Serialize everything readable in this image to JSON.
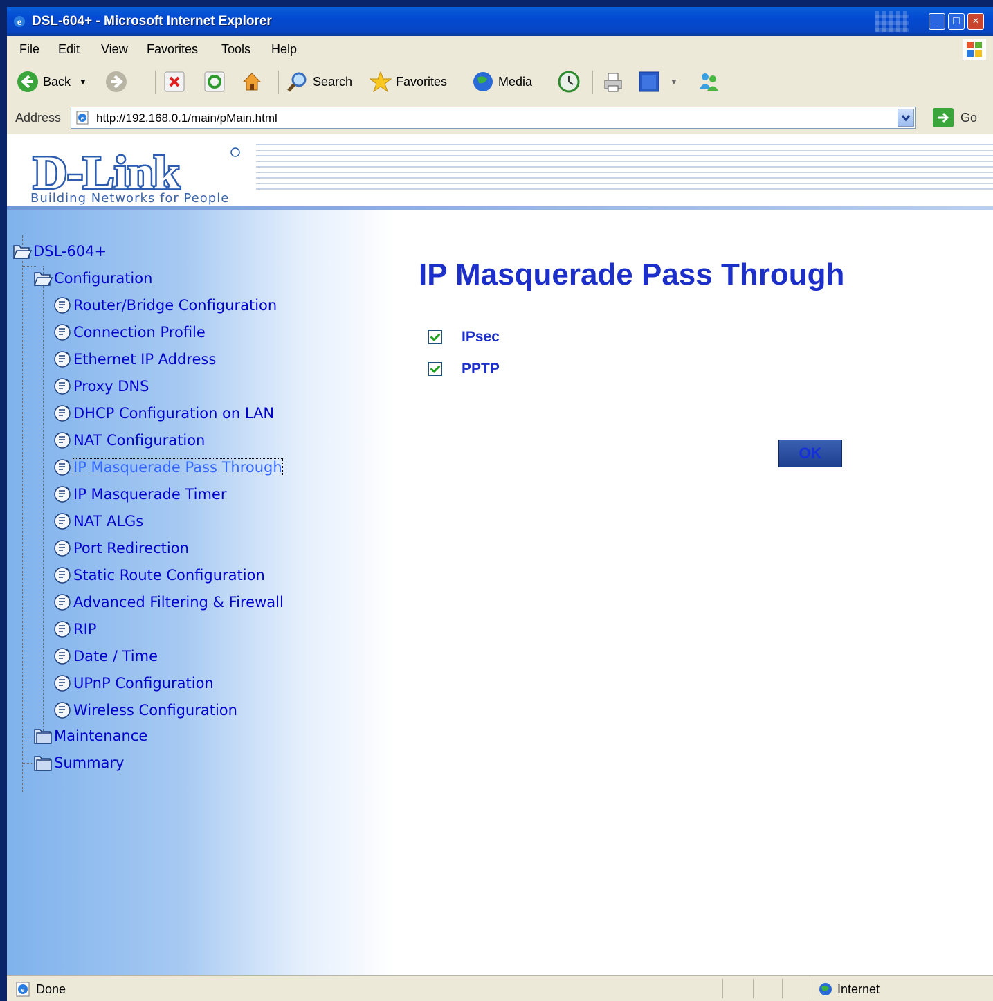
{
  "window": {
    "title": "DSL-604+ - Microsoft Internet Explorer"
  },
  "menu": {
    "items": [
      "File",
      "Edit",
      "View",
      "Favorites",
      "Tools",
      "Help"
    ]
  },
  "toolbar": {
    "back_label": "Back",
    "search_label": "Search",
    "favorites_label": "Favorites",
    "media_label": "Media"
  },
  "address": {
    "label": "Address",
    "url": "http://192.168.0.1/main/pMain.html",
    "go_label": "Go"
  },
  "banner": {
    "slogan": "Building Networks for People"
  },
  "tree": {
    "root": "DSL-604+",
    "configuration": "Configuration",
    "children": [
      "Router/Bridge Configuration",
      "Connection Profile",
      "Ethernet IP Address",
      "Proxy DNS",
      "DHCP Configuration on LAN",
      "NAT Configuration",
      "IP Masquerade Pass Through",
      "IP Masquerade Timer",
      "NAT ALGs",
      "Port Redirection",
      "Static Route Configuration",
      "Advanced Filtering & Firewall",
      "RIP",
      "Date / Time",
      "UPnP Configuration",
      "Wireless Configuration"
    ],
    "maintenance": "Maintenance",
    "summary": "Summary"
  },
  "page": {
    "title": "IP Masquerade Pass Through",
    "options": [
      {
        "label": "IPsec",
        "checked": true
      },
      {
        "label": "PPTP",
        "checked": true
      }
    ],
    "ok_label": "OK"
  },
  "status": {
    "text": "Done",
    "zone": "Internet"
  }
}
